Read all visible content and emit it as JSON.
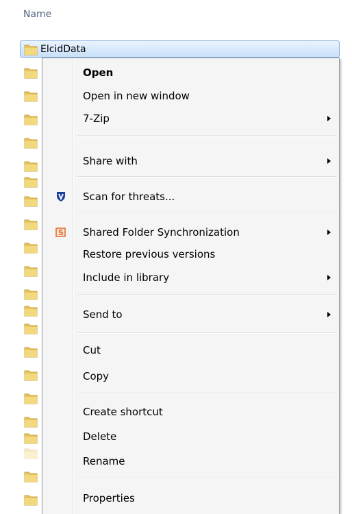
{
  "header": {
    "name_column": "Name"
  },
  "selected_item": {
    "label": "ElcidData"
  },
  "menu": {
    "open": "Open",
    "open_new_window": "Open in new window",
    "seven_zip": "7-Zip",
    "share_with": "Share with",
    "scan_threats": "Scan for threats...",
    "shared_folder_sync": "Shared Folder Synchronization",
    "restore_versions": "Restore previous versions",
    "include_library": "Include in library",
    "send_to": "Send to",
    "cut": "Cut",
    "copy": "Copy",
    "create_shortcut": "Create shortcut",
    "delete": "Delete",
    "rename": "Rename",
    "properties": "Properties"
  },
  "icons": {
    "folder": "folder-icon",
    "scan": "shield-icon",
    "sync": "sync-icon"
  },
  "colors": {
    "folder": "#e9c35b",
    "selection_border": "#84acdd",
    "menu_bg": "#f5f5f5",
    "scan_icon": "#1b3d9a",
    "sync_icon": "#e06a2a"
  }
}
